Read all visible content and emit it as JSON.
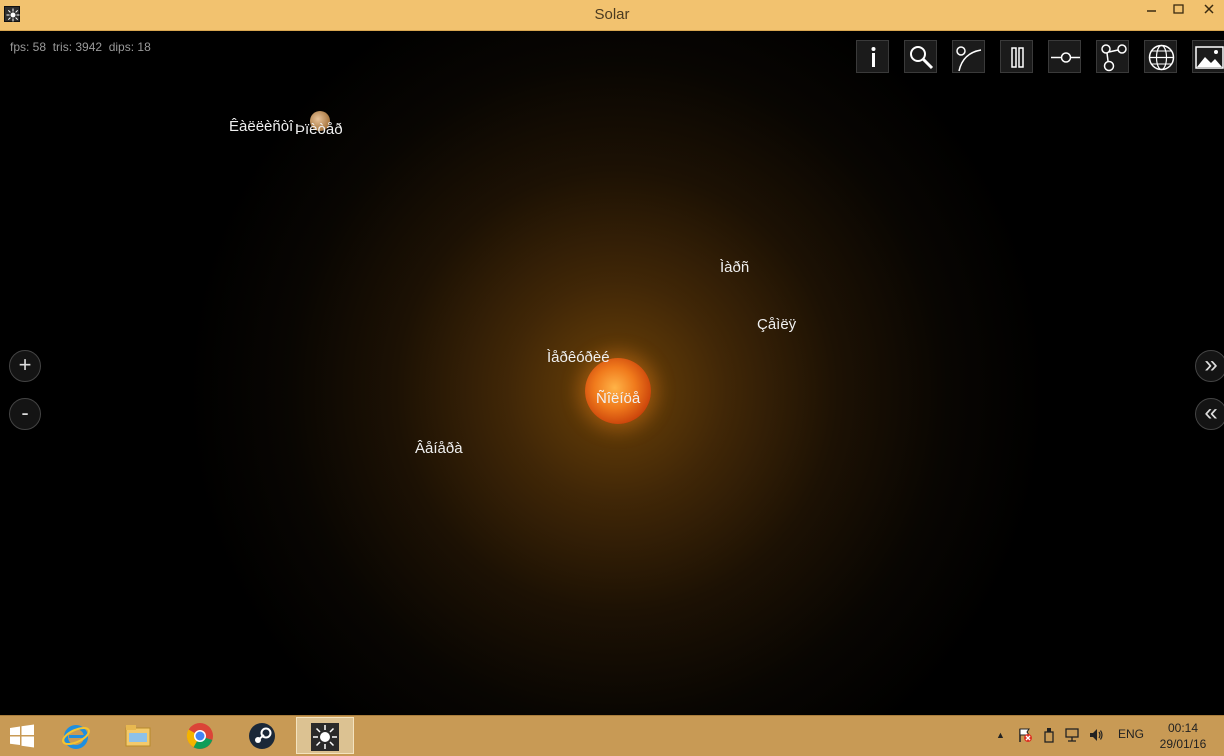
{
  "window": {
    "title": "Solar"
  },
  "stats": {
    "text": "fps: 58  tris: 3942  dips: 18"
  },
  "toolbar": {
    "icons": [
      "info-icon",
      "search-icon",
      "orbit-icon",
      "pause-icon",
      "timeline-icon",
      "hierarchy-icon",
      "globe-icon",
      "image-icon"
    ]
  },
  "side": {
    "zoom_in": "+",
    "zoom_out": "-",
    "forward": "»",
    "back": "«"
  },
  "labels": {
    "kallisto": "Êàëëèñòî",
    "jupiter": "Þïèòåð",
    "mars": "Ìàðñ",
    "earth": "Çåìëÿ",
    "mercury": "Ìåðêóðèé",
    "sun": "Ñîëíöå",
    "venus": "Âåíåðà"
  },
  "taskbar": {
    "apps": [
      "windows-start-icon",
      "internet-explorer-icon",
      "file-explorer-icon",
      "chrome-icon",
      "steam-icon",
      "solar-app-icon"
    ],
    "tray_arrow": "▲",
    "language": "ENG",
    "time": "00:14",
    "date": "29/01/16"
  }
}
